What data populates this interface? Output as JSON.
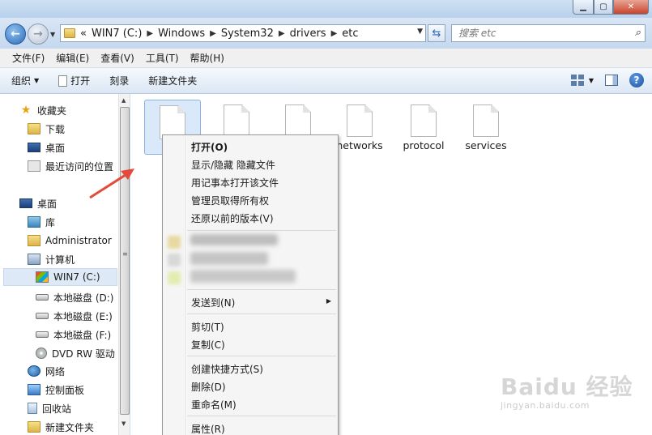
{
  "addressbar": {
    "overflow": "«",
    "crumbs": [
      "WIN7 (C:)",
      "Windows",
      "System32",
      "drivers",
      "etc"
    ]
  },
  "search": {
    "placeholder": "搜索 etc"
  },
  "menubar": [
    "文件(F)",
    "编辑(E)",
    "查看(V)",
    "工具(T)",
    "帮助(H)"
  ],
  "toolbar": {
    "organize": "组织",
    "open": "打开",
    "burn": "刻录",
    "new_folder": "新建文件夹"
  },
  "navpane": {
    "favorites": "收藏夹",
    "downloads": "下载",
    "desktop_fav": "桌面",
    "recent": "最近访问的位置",
    "desktop": "桌面",
    "libraries": "库",
    "administrator": "Administrator",
    "computer": "计算机",
    "drive_c": "WIN7 (C:)",
    "drive_d": "本地磁盘 (D:)",
    "drive_e": "本地磁盘 (E:)",
    "drive_f": "本地磁盘 (F:)",
    "dvd": "DVD RW 驱动",
    "network": "网络",
    "control_panel": "控制面板",
    "recycle_bin": "回收站",
    "new_folder": "新建文件夹"
  },
  "files": [
    "networks",
    "protocol",
    "services"
  ],
  "context_menu": {
    "open": "打开(O)",
    "show_hide": "显示/隐藏 隐藏文件",
    "notepad": "用记事本打开该文件",
    "take_ownership": "管理员取得所有权",
    "restore": "还原以前的版本(V)",
    "send_to": "发送到(N)",
    "cut": "剪切(T)",
    "copy": "复制(C)",
    "create_shortcut": "创建快捷方式(S)",
    "delete": "删除(D)",
    "rename": "重命名(M)",
    "properties": "属性(R)"
  },
  "watermark": {
    "logo": "Baidu 经验",
    "sub": "jingyan.baidu.com"
  },
  "colors": {
    "accent_arrow": "#e34a3b",
    "selection": "#d9e9f9"
  }
}
